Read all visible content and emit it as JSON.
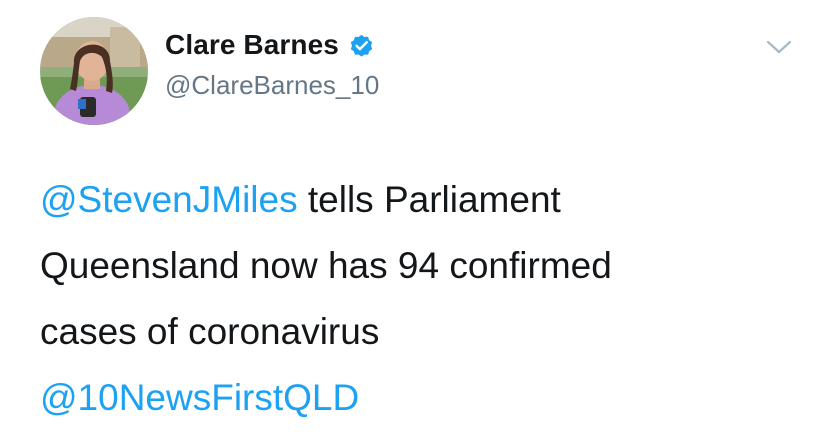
{
  "tweet": {
    "author": {
      "display_name": "Clare Barnes",
      "handle": "@ClareBarnes_10",
      "verified": true
    },
    "text": {
      "mention_1": "@StevenJMiles",
      "line_1_rest": " tells Parliament",
      "line_2": "Queensland now has 94 confirmed",
      "line_3": "cases of coronavirus",
      "mention_2": "@10NewsFirstQLD"
    },
    "icons": {
      "verified": "verified-badge-icon",
      "menu": "chevron-down-icon"
    }
  },
  "colors": {
    "text": "#14171a",
    "secondary": "#657786",
    "link": "#1da1f2",
    "verified": "#1da1f2",
    "chevron": "#aab8c2"
  }
}
